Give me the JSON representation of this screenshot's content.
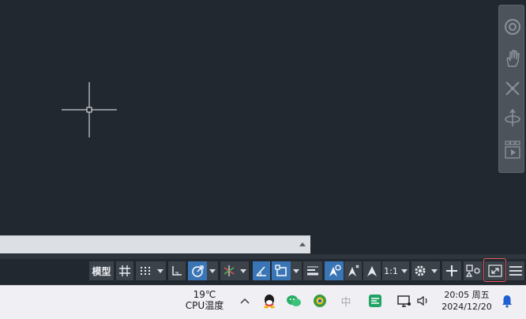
{
  "status_bar": {
    "model_label": "模型",
    "annotation_scale": "1:1",
    "accent_color": "#3a76b6"
  },
  "taskbar": {
    "weather": {
      "temperature": "19℃",
      "label": "CPU温度"
    },
    "ime_label": "中",
    "clock": {
      "time": "20:05 周五",
      "date": "2024/12/20"
    }
  },
  "icons": [
    "pan-hand-icon",
    "orbit-icon",
    "steering-wheel-icon",
    "showmotion-icon",
    "grid-icon",
    "snap-icon",
    "ortho-icon",
    "polar-icon",
    "isodraft-icon",
    "osnap-track-icon",
    "object-snap-icon",
    "lineweight-icon",
    "annotation-monitor-icon",
    "autoscale-icon",
    "annotation-visibility-icon",
    "gear-icon",
    "plus-icon",
    "isolate-icon",
    "fullscreen-icon",
    "hamburger-menu-icon",
    "chevron-up-icon",
    "qq-icon",
    "wechat-icon",
    "app-icon",
    "ime-icon",
    "wps-icon",
    "monitor-icon",
    "volume-icon",
    "notification-bell-icon"
  ]
}
